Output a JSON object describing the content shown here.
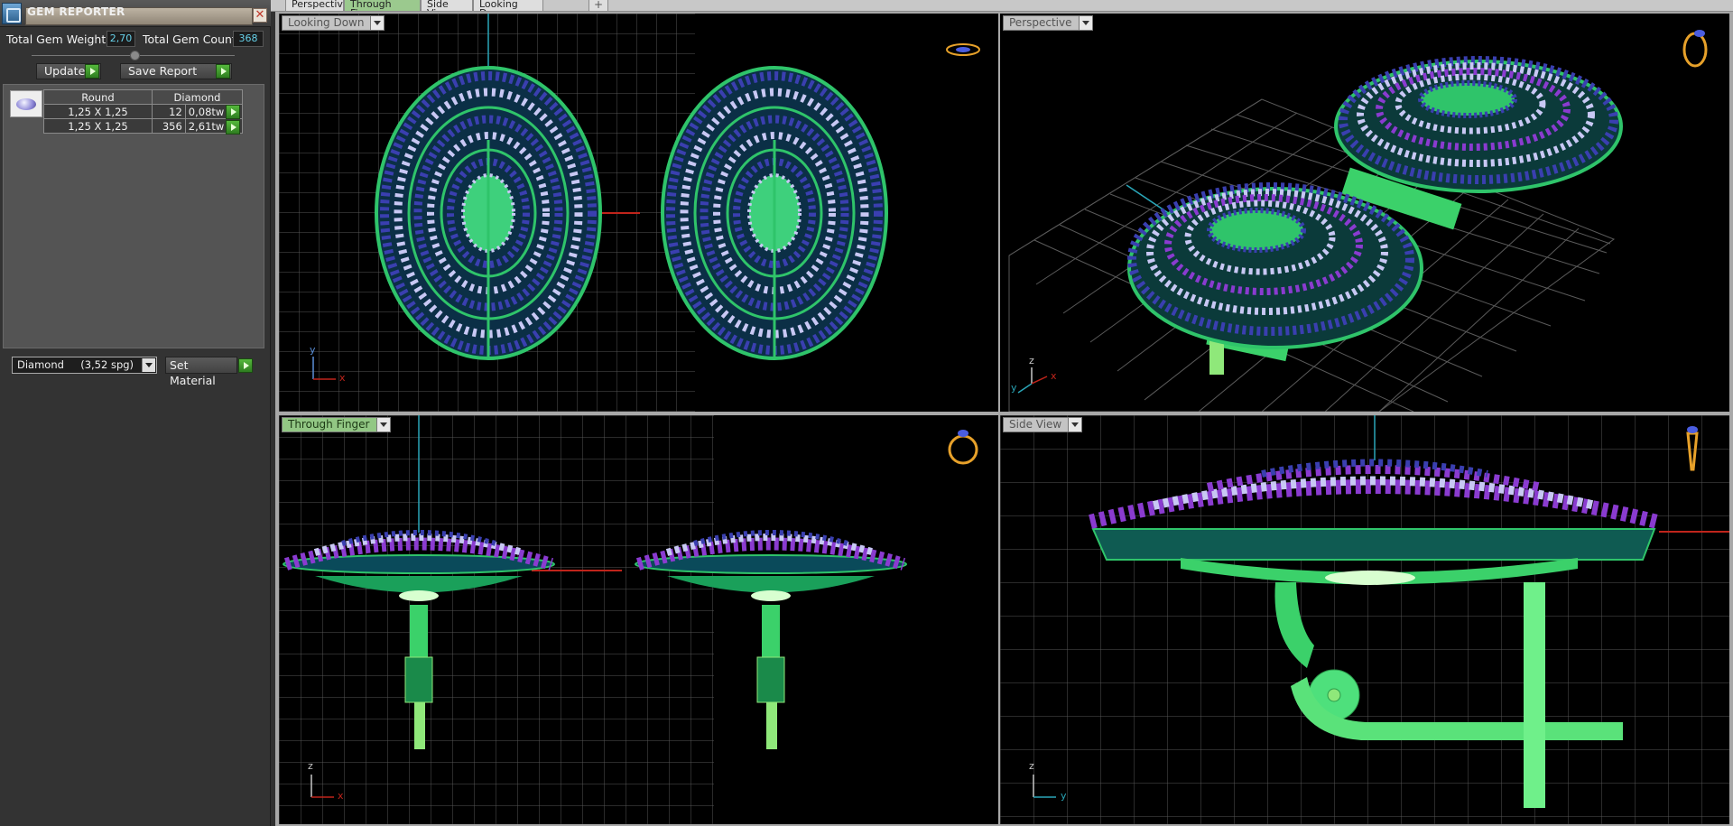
{
  "panel": {
    "title": "GEM REPORTER",
    "close_label": "✕",
    "total_gem_weight_label": "Total Gem Weight",
    "total_gem_weight_value": "2,70",
    "total_gem_count_label": "Total Gem Count",
    "total_gem_count_value": "368",
    "update_label": "Update",
    "save_report_label": "Save Report",
    "table": {
      "headers": [
        "Round",
        "Diamond"
      ],
      "rows": [
        {
          "size": "1,25 X 1,25",
          "count": "12",
          "weight": "0,08tw"
        },
        {
          "size": "1,25 X 1,25",
          "count": "356",
          "weight": "2,61tw"
        }
      ]
    },
    "material_select": "Diamond     (3,52 spg)",
    "set_material_label": "Set Material"
  },
  "tabs": [
    {
      "label": "Perspective"
    },
    {
      "label": "Through Finger"
    },
    {
      "label": "Side View"
    },
    {
      "label": "Looking Down"
    }
  ],
  "tab_add": "+",
  "viewports": {
    "top_left": {
      "label": "Looking Down",
      "axis_a": "y",
      "axis_b": "x"
    },
    "top_right": {
      "label": "Perspective",
      "axis_a": "z",
      "axis_b": "x",
      "axis_c": "y"
    },
    "bottom_left": {
      "label": "Through Finger",
      "axis_a": "z",
      "axis_b": "x"
    },
    "bottom_right": {
      "label": "Side View",
      "axis_a": "z",
      "axis_b": "y"
    }
  },
  "colors": {
    "grid": "#5a5a5a",
    "metal": "#2fc46a",
    "metal_light": "#8fe87a",
    "gem_blue": "#3a3fb0",
    "gem_purple": "#8a3bd0",
    "gem_white": "#c8c8f4",
    "accent_green": "#9bc98e"
  }
}
